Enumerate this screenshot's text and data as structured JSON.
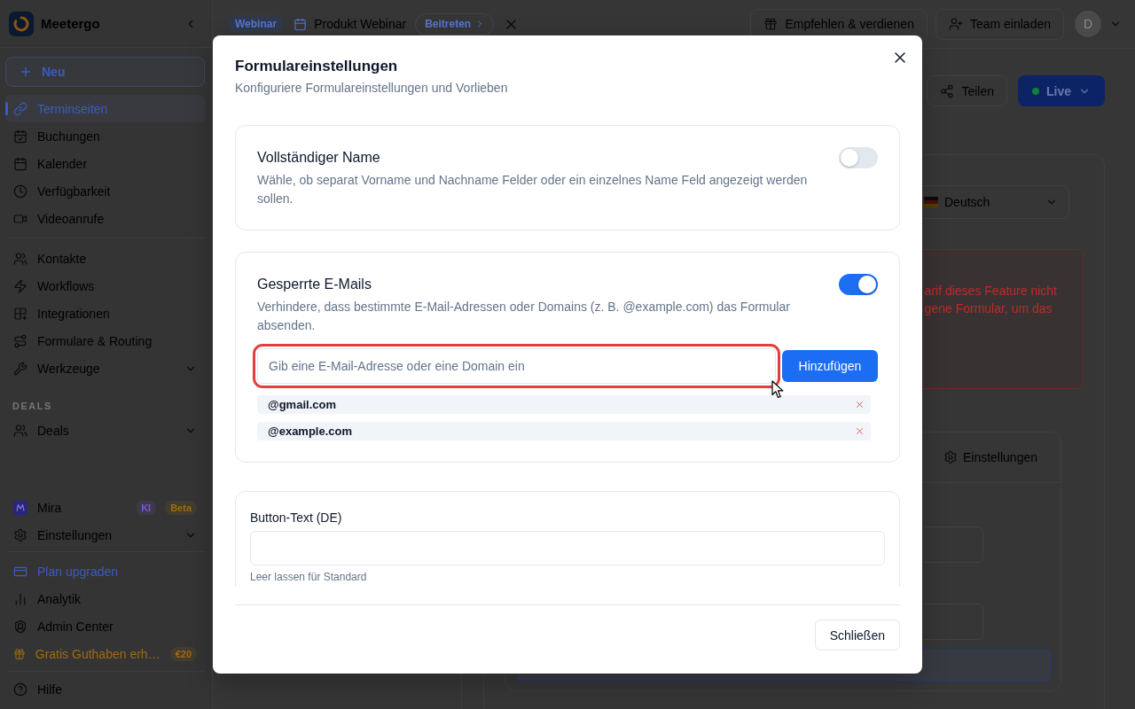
{
  "sidebar": {
    "brand": "Meetergo",
    "new_button": "Neu",
    "top_sections": [
      {
        "items": [
          {
            "label": "Terminseiten",
            "kind": "link",
            "selected": true
          },
          {
            "label": "Buchungen",
            "kind": "link",
            "selected": false
          },
          {
            "label": "Kalender",
            "kind": "link",
            "selected": false
          },
          {
            "label": "Verfügbarkeit",
            "kind": "link",
            "selected": false
          },
          {
            "label": "Videoanrufe",
            "kind": "link",
            "selected": false
          }
        ]
      },
      {
        "items": [
          {
            "label": "Kontakte",
            "kind": "link",
            "selected": false
          },
          {
            "label": "Workflows",
            "kind": "link",
            "selected": false
          },
          {
            "label": "Integrationen",
            "kind": "link",
            "selected": false
          },
          {
            "label": "Formulare & Routing",
            "kind": "link",
            "selected": false
          },
          {
            "label": "Werkzeuge",
            "kind": "group",
            "expanded": false,
            "selected": false
          }
        ]
      },
      {
        "heading": "DEALS",
        "items": [
          {
            "label": "Deals",
            "kind": "group",
            "expanded": false,
            "selected": false
          }
        ]
      }
    ],
    "bottom_sections": [
      {
        "items": [
          {
            "label": "Mira",
            "kind": "link",
            "selected": false,
            "badges": [
              {
                "text": "KI",
                "color": "#7b5ad0"
              },
              {
                "text": "Beta",
                "color": "#a06a14"
              }
            ]
          },
          {
            "label": "Einstellungen",
            "kind": "group",
            "expanded": false,
            "selected": false
          }
        ]
      },
      {
        "items": [
          {
            "label": "Plan upgraden",
            "kind": "upgrade",
            "selected": false
          },
          {
            "label": "Analytik",
            "kind": "link",
            "selected": false
          },
          {
            "label": "Admin Center",
            "kind": "link",
            "selected": false
          },
          {
            "label": "Gratis Guthaben erh…",
            "kind": "promo",
            "selected": false,
            "badges": [
              {
                "text": "€20",
                "color": "#a06a14"
              }
            ]
          }
        ]
      },
      {
        "items": [
          {
            "label": "Hilfe",
            "kind": "link",
            "selected": false
          }
        ]
      }
    ]
  },
  "topbar": {
    "tag": "Webinar",
    "title": "Produkt Webinar",
    "join_button": "Beitreten",
    "actions": [
      "Empfehlen & verdienen",
      "Team einladen"
    ],
    "avatar": "D"
  },
  "page": {
    "share_button": "Teilen",
    "status_button": {
      "label": "Live",
      "live": true
    },
    "language_select": {
      "value": "Deutsch"
    },
    "alert": {
      "lines": [
        "arif dieses Feature nicht",
        "gene Formular, um das"
      ]
    },
    "settings_card": {
      "tabs": [
        {
          "label": "Einstellungen",
          "selected": false
        }
      ]
    }
  },
  "modal": {
    "title": "Formulareinstellungen",
    "subtitle": "Konfiguriere Formulareinstellungen und Vorlieben",
    "sections": [
      {
        "kind": "toggle",
        "title": "Vollständiger Name",
        "description": "Wähle, ob separat Vorname und Nachname Felder oder ein einzelnes Name Feld angezeigt werden sollen.",
        "on": false
      },
      {
        "kind": "blocklist",
        "title": "Gesperrte E-Mails",
        "description": "Verhindere, dass bestimmte E-Mail-Adressen oder Domains (z. B. @example.com) das Formular absenden.",
        "on": true,
        "input": {
          "placeholder": "Gib eine E-Mail-Adresse oder eine Domain ein",
          "highlighted": true
        },
        "add_button": "Hinzufügen",
        "entries": [
          "@gmail.com",
          "@example.com"
        ]
      },
      {
        "kind": "text_field",
        "label": "Button-Text (DE)",
        "hint": "Leer lassen für Standard"
      }
    ],
    "close_button": "Schließen"
  }
}
